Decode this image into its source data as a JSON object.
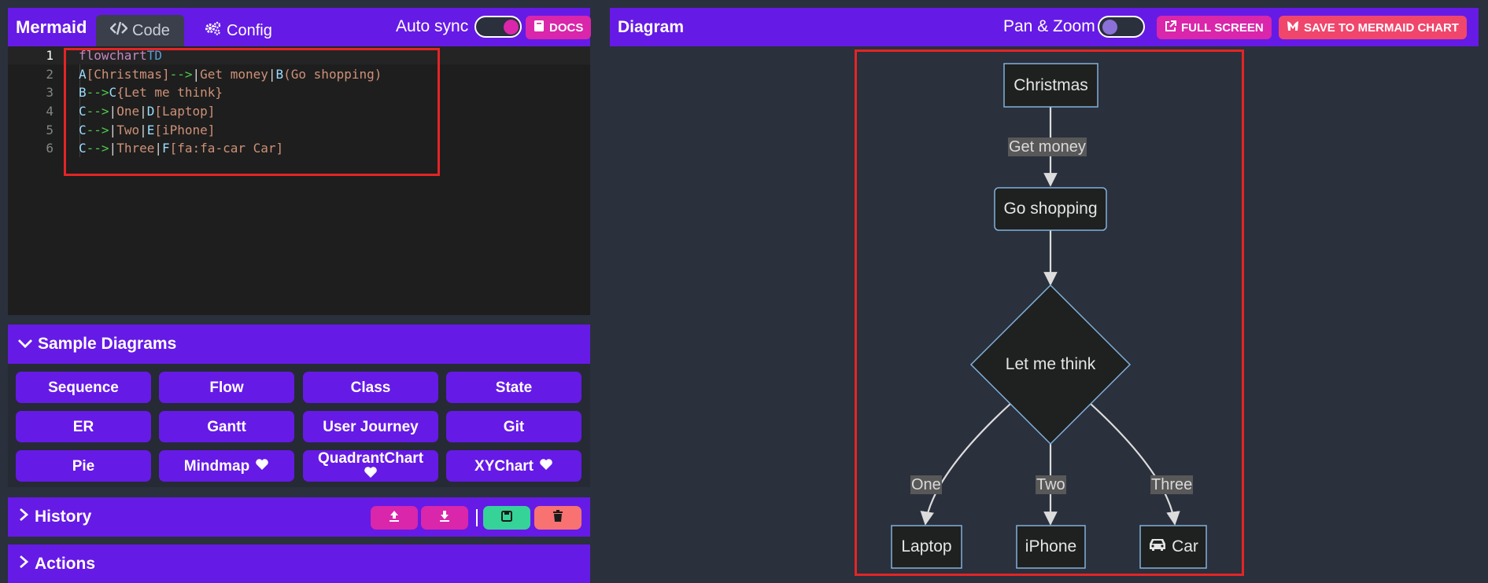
{
  "editor_header": {
    "brand": "Mermaid",
    "tab_code": "Code",
    "tab_config": "Config",
    "auto_sync_label": "Auto sync",
    "docs_label": "DOCS"
  },
  "diagram_header": {
    "title": "Diagram",
    "pan_zoom_label": "Pan & Zoom",
    "full_screen_label": "FULL SCREEN",
    "save_label": "SAVE TO MERMAID CHART"
  },
  "editor": {
    "line_numbers": [
      "1",
      "2",
      "3",
      "4",
      "5",
      "6"
    ],
    "lines": [
      "flowchart TD",
      "    A[Christmas] -->|Get money| B(Go shopping)",
      "    B --> C{Let me think}",
      "    C -->|One| D[Laptop]",
      "    C -->|Two| E[iPhone]",
      "    C -->|Three| F[fa:fa-car Car]"
    ]
  },
  "samples": {
    "title": "Sample Diagrams",
    "items": [
      "Sequence",
      "Flow",
      "Class",
      "State",
      "ER",
      "Gantt",
      "User Journey",
      "Git",
      "Pie",
      "Mindmap",
      "QuadrantChart",
      "XYChart"
    ]
  },
  "history": {
    "title": "History"
  },
  "actions": {
    "title": "Actions"
  },
  "flowchart": {
    "nodes": {
      "A": "Christmas",
      "B": "Go shopping",
      "C": "Let me think",
      "D": "Laptop",
      "E": "iPhone",
      "F": "Car"
    },
    "edges": {
      "AB": "Get money",
      "CD": "One",
      "CE": "Two",
      "CF": "Three"
    }
  },
  "colors": {
    "primary": "#661ae6",
    "pink": "#d926aa",
    "green": "#1fb2a5",
    "orange": "#f87272",
    "save_red": "#f0466c",
    "highlight": "#e32525"
  }
}
